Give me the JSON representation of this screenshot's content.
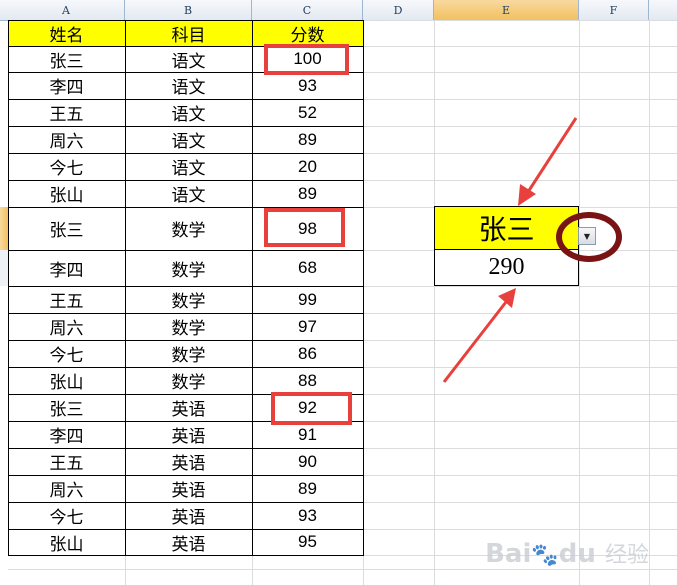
{
  "column_headers": [
    "A",
    "B",
    "C",
    "D",
    "E",
    "F"
  ],
  "table": {
    "headers": [
      "姓名",
      "科目",
      "分数"
    ],
    "rows": [
      [
        "张三",
        "语文",
        "100"
      ],
      [
        "李四",
        "语文",
        "93"
      ],
      [
        "王五",
        "语文",
        "52"
      ],
      [
        "周六",
        "语文",
        "89"
      ],
      [
        "今七",
        "语文",
        "20"
      ],
      [
        "张山",
        "语文",
        "89"
      ],
      [
        "张三",
        "数学",
        "98"
      ],
      [
        "李四",
        "数学",
        "68"
      ],
      [
        "王五",
        "数学",
        "99"
      ],
      [
        "周六",
        "数学",
        "97"
      ],
      [
        "今七",
        "数学",
        "86"
      ],
      [
        "张山",
        "数学",
        "88"
      ],
      [
        "张三",
        "英语",
        "92"
      ],
      [
        "李四",
        "英语",
        "91"
      ],
      [
        "王五",
        "英语",
        "90"
      ],
      [
        "周六",
        "英语",
        "89"
      ],
      [
        "今七",
        "英语",
        "93"
      ],
      [
        "张山",
        "英语",
        "95"
      ]
    ]
  },
  "lookup": {
    "name": "张三",
    "result": "290"
  },
  "colors": {
    "header_fill": "#ffff00",
    "highlight_box": "#e8403c",
    "arrow": "#e8403c",
    "circle": "#7a1414"
  },
  "icons": {
    "dropdown": "dropdown-arrow-icon"
  },
  "watermark": {
    "brand": "Bai",
    "paw": "🐾",
    "suffix": "du",
    "site": "经验"
  }
}
